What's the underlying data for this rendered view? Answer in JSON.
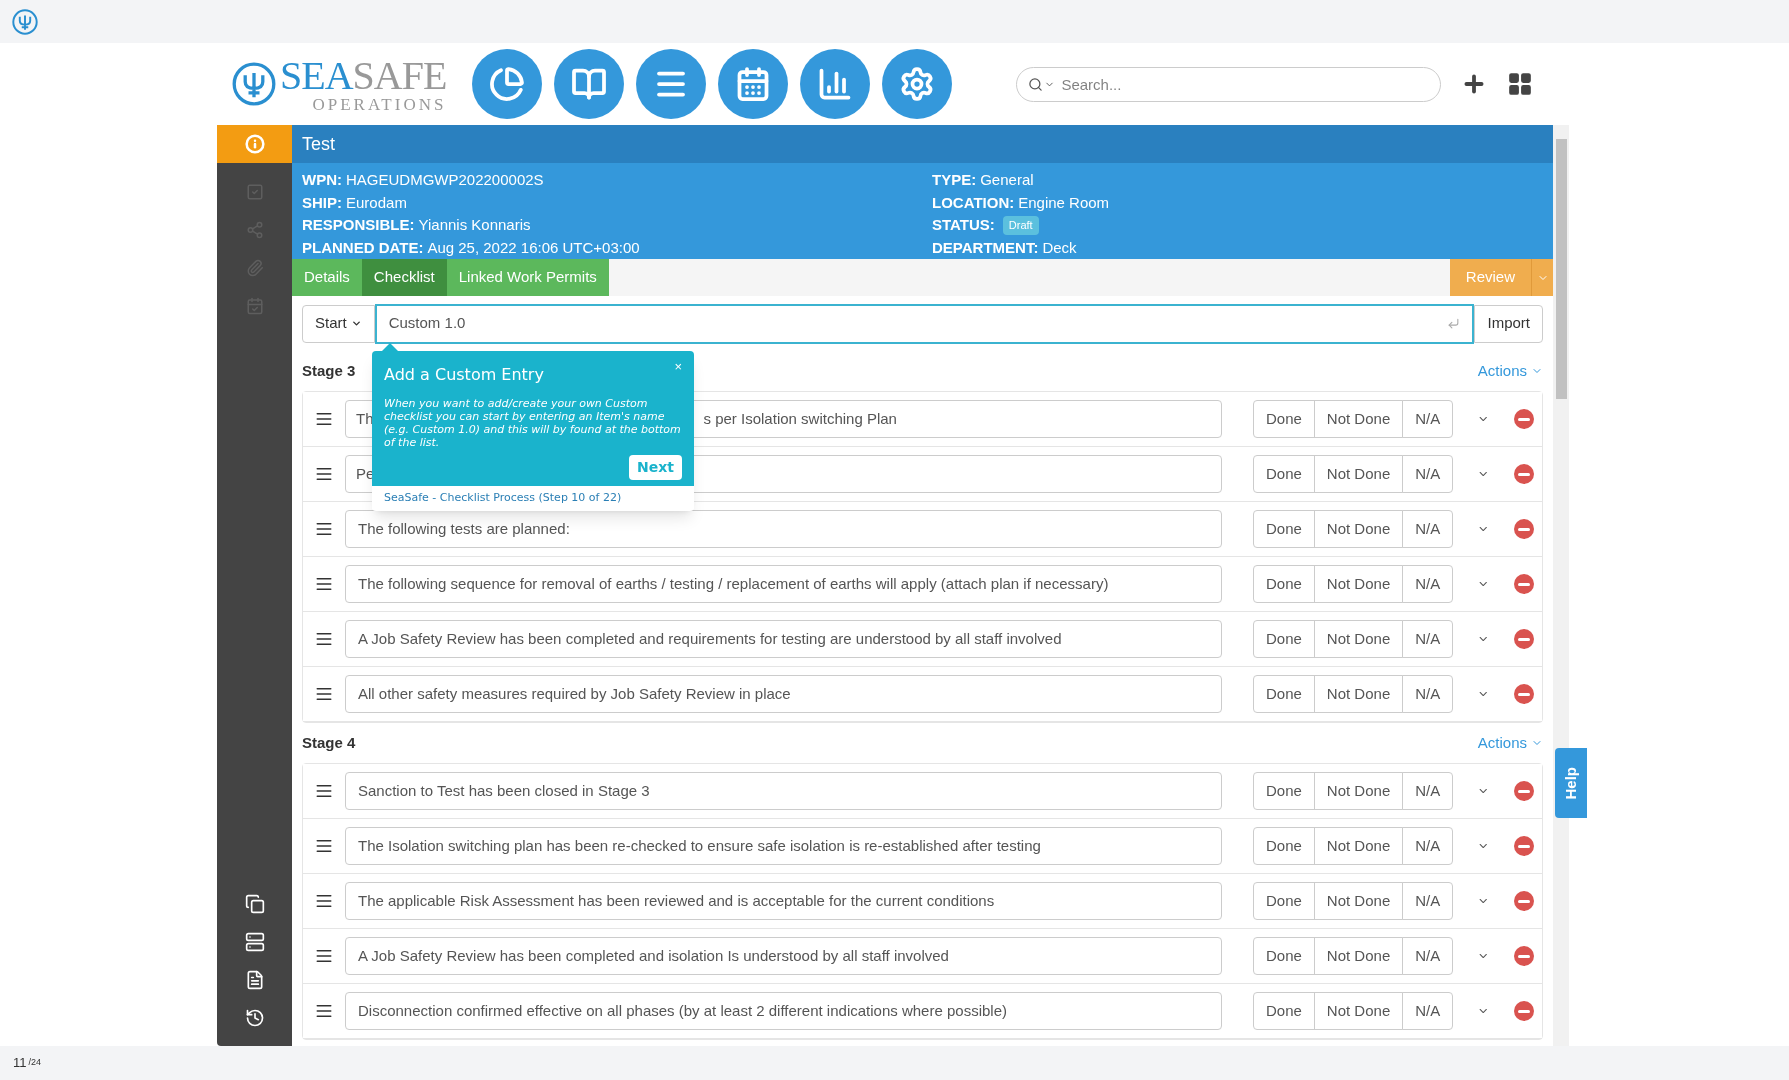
{
  "logo": {
    "part1": "SEA",
    "part2": "SAFE",
    "sub": "OPERATIONS"
  },
  "search": {
    "placeholder": "Search..."
  },
  "record": {
    "title": "Test",
    "fields_left": [
      {
        "label": "WPN:",
        "value": "HAGEUDMGWP202200002S"
      },
      {
        "label": "SHIP:",
        "value": "Eurodam"
      },
      {
        "label": "RESPONSIBLE:",
        "value": "Yiannis Konnaris"
      },
      {
        "label": "PLANNED DATE:",
        "value": "Aug 25, 2022 16:06 UTC+03:00"
      }
    ],
    "fields_right": [
      {
        "label": "TYPE:",
        "value": "General"
      },
      {
        "label": "LOCATION:",
        "value": "Engine Room"
      },
      {
        "label": "STATUS:",
        "value": "Draft",
        "kind": "badge"
      },
      {
        "label": "DEPARTMENT:",
        "value": "Deck"
      }
    ]
  },
  "tabs": [
    {
      "label": "Details",
      "selected": false
    },
    {
      "label": "Checklist",
      "selected": true
    },
    {
      "label": "Linked Work Permits",
      "selected": false
    }
  ],
  "review_button": "Review",
  "entry": {
    "start": "Start",
    "value": "Custom 1.0",
    "import": "Import"
  },
  "stages": [
    {
      "title": "Stage 3",
      "actions": "Actions",
      "items": [
        {
          "kind": "covered",
          "text": "Th",
          "text_end": "s per Isolation switching Plan",
          "answers": [
            "Done",
            "Not Done",
            "N/A"
          ]
        },
        {
          "kind": "covered",
          "text": "Pe",
          "answers": [
            "Done",
            "Not Done",
            "N/A"
          ]
        },
        {
          "kind": "plain",
          "text": "The following tests are planned:",
          "answers": [
            "Done",
            "Not Done",
            "N/A"
          ]
        },
        {
          "kind": "plain",
          "text": "The following sequence for removal of earths / testing / replacement of earths will apply (attach plan if necessary)",
          "answers": [
            "Done",
            "Not Done",
            "N/A"
          ]
        },
        {
          "kind": "plain",
          "text": "A Job Safety Review has been completed and requirements for testing are  understood by all staff involved",
          "answers": [
            "Done",
            "Not Done",
            "N/A"
          ]
        },
        {
          "kind": "plain",
          "text": "All other safety measures required by Job Safety Review in place",
          "answers": [
            "Done",
            "Not Done",
            "N/A"
          ]
        }
      ]
    },
    {
      "title": "Stage 4",
      "actions": "Actions",
      "items": [
        {
          "kind": "plain",
          "text": "Sanction to Test has been closed in Stage 3",
          "answers": [
            "Done",
            "Not Done",
            "N/A"
          ]
        },
        {
          "kind": "plain",
          "text": "The Isolation switching plan has been re-checked to ensure safe isolation is re-established after testing",
          "answers": [
            "Done",
            "Not Done",
            "N/A"
          ]
        },
        {
          "kind": "plain",
          "text": "The applicable Risk Assessment has been reviewed and is acceptable for the current conditions",
          "answers": [
            "Done",
            "Not Done",
            "N/A"
          ]
        },
        {
          "kind": "plain",
          "text": "A Job Safety Review has been completed and isolation Is understood by all staff involved",
          "answers": [
            "Done",
            "Not Done",
            "N/A"
          ]
        },
        {
          "kind": "plain",
          "text": "Disconnection confirmed effective on all phases (by at least 2 different indications where possible)",
          "answers": [
            "Done",
            "Not Done",
            "N/A"
          ]
        }
      ]
    }
  ],
  "popup": {
    "title": "Add a Custom Entry",
    "body": "When you want to add/create your own Custom checklist you can start by entering an Item's name (e.g. Custom 1.0) and this will by found at the bottom of the list.",
    "close": "×",
    "next": "Next",
    "footer": "SeaSafe - Checklist Process (Step 10 of 22)"
  },
  "help": "Help",
  "page": {
    "current": "11",
    "total": "/24"
  }
}
